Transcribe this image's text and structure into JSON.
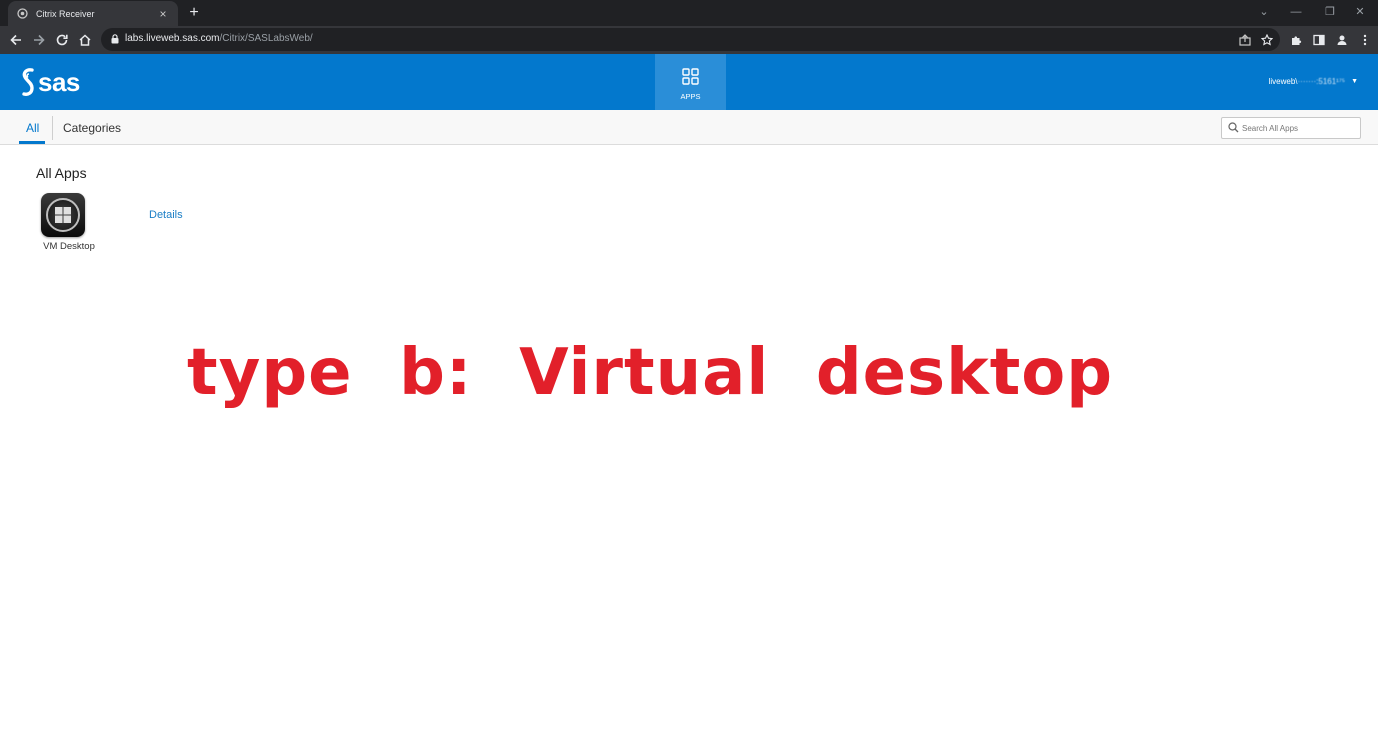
{
  "browser": {
    "tab_title": "Citrix Receiver",
    "new_tab_symbol": "+",
    "tab_close_symbol": "×",
    "url_host": "labs.liveweb.sas.com",
    "url_path": "/Citrix/SASLabsWeb/",
    "window_controls": [
      "⌄",
      "—",
      "❐",
      "✕"
    ]
  },
  "header": {
    "logo_text": "sas",
    "apps_label": "APPS",
    "user_name": "liveweb\\",
    "user_redacted": "·······:5161¹⁷⁵",
    "caret": "▼"
  },
  "subnav": {
    "tabs": [
      {
        "label": "All",
        "active": true
      },
      {
        "label": "Categories",
        "active": false
      }
    ],
    "search_placeholder": "Search All Apps"
  },
  "main": {
    "heading": "All Apps",
    "apps": [
      {
        "name": "VM Desktop",
        "details_label": "Details",
        "icon": "windows-logo-icon"
      }
    ]
  },
  "annotation": {
    "text": "type  b:  Virtual  desktop",
    "color": "#e2202a"
  },
  "colors": {
    "sas_blue": "#0378cd",
    "apps_tab_active": "#2a8ed8",
    "link_blue": "#1a7ec6"
  }
}
